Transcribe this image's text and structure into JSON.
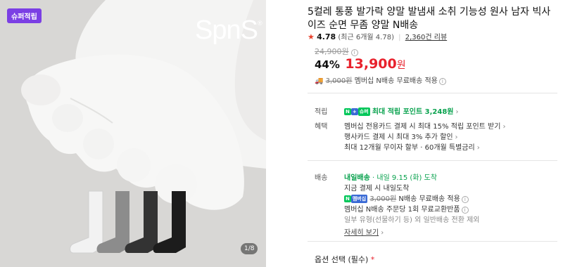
{
  "gallery": {
    "badge": "슈퍼적립",
    "brand": "SpnS",
    "brand_mark": "®",
    "counter": "1/8"
  },
  "product": {
    "title": "5컬레 통풍 발가락 양말 발냄새 소취 기능성 원사 남자 빅사이즈 순면 무좀 양말 N배송",
    "rating_star": "★",
    "rating": "4.78",
    "rating_detail": "(최근 6개월 4.78",
    "reviews": "2,360건 리뷰",
    "original_price": "24,900원",
    "discount": "44%",
    "price": "13,900",
    "price_unit": "원",
    "shipping_old": "3,000원",
    "shipping_text": "멤버십 N배송 무료배송 적용"
  },
  "points": {
    "label": "적립",
    "np": "N",
    "plus": "+",
    "super": "슈퍼",
    "text": "최대 적립 포인트 3,248원"
  },
  "benefits": {
    "label": "혜택",
    "lines": [
      "멤버십 전용카드 결제 시 최대 15% 적립 포인트 받기",
      "행사카드 결제 시 최대 3% 추가 할인",
      "최대 12개월 무이자 할부 · 60개월 특별금리"
    ]
  },
  "delivery": {
    "label": "배송",
    "tag": "내일배송",
    "tag_suffix": "· 내일 9.15 (화) 도착",
    "line2": "지금 결제 시 내일도착",
    "membership_badge": "멤버십",
    "line3_old": "3,000원",
    "line3_text": "N배송 무료배송 적용",
    "line4": "멤버십 N배송 주문당 1회 무료교환반품",
    "line5": "일부 유형(선물하기 등) 외 일반배송 전환 제외",
    "more": "자세히 보기"
  },
  "options": {
    "label": "옵션 선택 (필수)",
    "required_mark": "*"
  },
  "colors": {
    "accent_red": "#e8212c",
    "naver_green": "#03c75a",
    "badge_purple": "#7b3fe4"
  }
}
